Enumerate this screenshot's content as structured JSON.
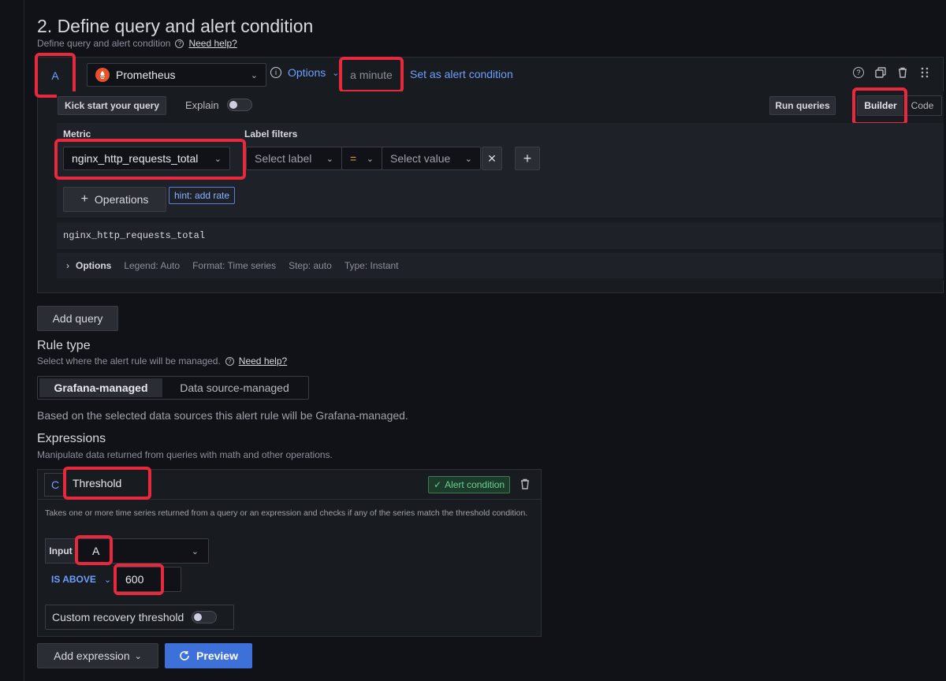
{
  "section": {
    "title": "2. Define query and alert condition",
    "subtitle": "Define query and alert condition",
    "help_link": "Need help?"
  },
  "query": {
    "ref_id": "A",
    "datasource": "Prometheus",
    "options_label": "Options",
    "interval": "a minute",
    "set_condition_label": "Set as alert condition",
    "kickstart_label": "Kick start your query",
    "explain_label": "Explain",
    "run_queries_label": "Run queries",
    "builder_label": "Builder",
    "code_label": "Code",
    "metric_label": "Metric",
    "label_filters_label": "Label filters",
    "metric_value": "nginx_http_requests_total",
    "select_label_placeholder": "Select label",
    "operator": "=",
    "select_value_placeholder": "Select value",
    "operations_label": "Operations",
    "hint_label": "hint: add rate",
    "raw_query": "nginx_http_requests_total",
    "options_row": {
      "label": "Options",
      "legend": "Legend: Auto",
      "format": "Format: Time series",
      "step": "Step: auto",
      "type": "Type: Instant"
    }
  },
  "add_query_label": "Add query",
  "rule_type": {
    "title": "Rule type",
    "subtitle": "Select where the alert rule will be managed.",
    "help_link": "Need help?",
    "options": [
      "Grafana-managed",
      "Data source-managed"
    ],
    "selected": "Grafana-managed",
    "note": "Based on the selected data sources this alert rule will be Grafana-managed."
  },
  "expressions": {
    "title": "Expressions",
    "subtitle": "Manipulate data returned from queries with math and other operations.",
    "ref_id": "C",
    "name": "Threshold",
    "alert_condition_badge": "Alert condition",
    "description": "Takes one or more time series returned from a query or an expression and checks if any of the series match the threshold condition.",
    "input_label": "Input",
    "input_value": "A",
    "comparator": "IS ABOVE",
    "threshold_value": "600",
    "recovery_label": "Custom recovery threshold"
  },
  "footer": {
    "add_expression_label": "Add expression",
    "preview_label": "Preview"
  },
  "colors": {
    "accent_blue": "#6e9fff",
    "preview_button": "#3d71d9",
    "highlight": "#e8283c",
    "success": "#6ccf8e"
  }
}
